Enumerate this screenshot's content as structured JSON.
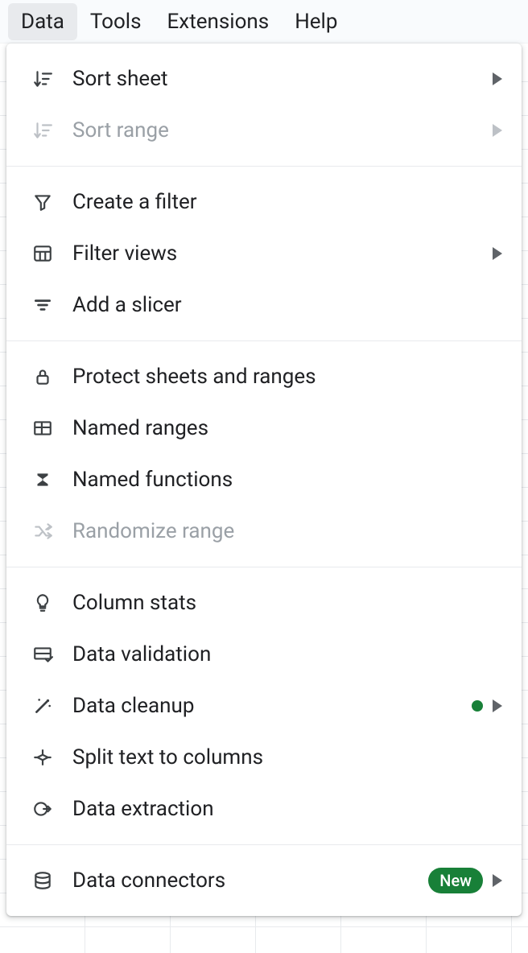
{
  "menubar": {
    "items": [
      "Data",
      "Tools",
      "Extensions",
      "Help"
    ],
    "active_index": 0
  },
  "dropdown": {
    "groups": [
      [
        {
          "id": "sort-sheet",
          "label": "Sort sheet",
          "icon": "sort-sheet-icon",
          "disabled": false,
          "submenu": true
        },
        {
          "id": "sort-range",
          "label": "Sort range",
          "icon": "sort-range-icon",
          "disabled": true,
          "submenu": true
        }
      ],
      [
        {
          "id": "create-filter",
          "label": "Create a filter",
          "icon": "filter-icon",
          "disabled": false
        },
        {
          "id": "filter-views",
          "label": "Filter views",
          "icon": "filter-views-icon",
          "disabled": false,
          "submenu": true
        },
        {
          "id": "add-slicer",
          "label": "Add a slicer",
          "icon": "slicer-icon",
          "disabled": false
        }
      ],
      [
        {
          "id": "protect",
          "label": "Protect sheets and ranges",
          "icon": "lock-icon",
          "disabled": false
        },
        {
          "id": "named-ranges",
          "label": "Named ranges",
          "icon": "named-ranges-icon",
          "disabled": false
        },
        {
          "id": "named-functions",
          "label": "Named functions",
          "icon": "sigma-icon",
          "disabled": false
        },
        {
          "id": "randomize",
          "label": "Randomize range",
          "icon": "shuffle-icon",
          "disabled": true
        }
      ],
      [
        {
          "id": "column-stats",
          "label": "Column stats",
          "icon": "bulb-icon",
          "disabled": false
        },
        {
          "id": "data-validation",
          "label": "Data validation",
          "icon": "validation-icon",
          "disabled": false
        },
        {
          "id": "data-cleanup",
          "label": "Data cleanup",
          "icon": "wand-icon",
          "disabled": false,
          "submenu": true,
          "dot": true
        },
        {
          "id": "split-text",
          "label": "Split text to columns",
          "icon": "split-icon",
          "disabled": false
        },
        {
          "id": "data-extraction",
          "label": "Data extraction",
          "icon": "extraction-icon",
          "disabled": false
        }
      ],
      [
        {
          "id": "data-connectors",
          "label": "Data connectors",
          "icon": "database-icon",
          "disabled": false,
          "submenu": true,
          "badge": "New"
        }
      ]
    ]
  }
}
